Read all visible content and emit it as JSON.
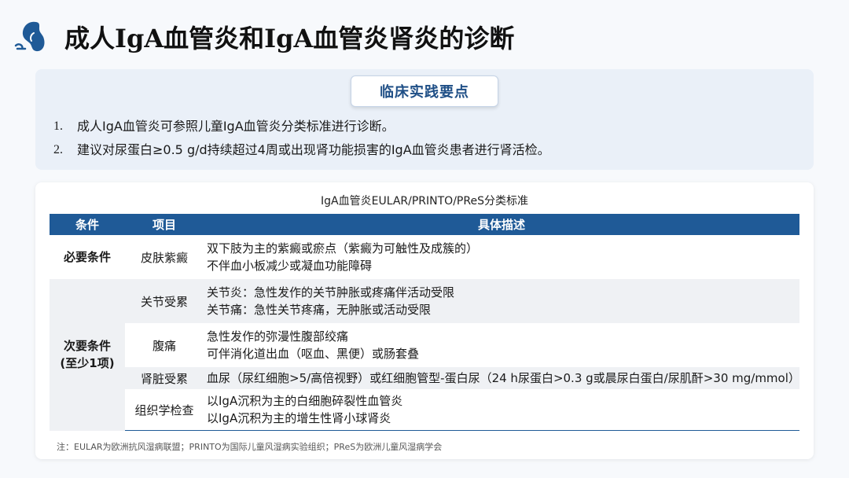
{
  "header": {
    "title": "成人IgA血管炎和IgA血管炎肾炎的诊断",
    "logo_icon": "kidney-icon",
    "accent_color": "#1f5a97"
  },
  "practice_points": {
    "heading": "临床实践要点",
    "items": [
      {
        "num": "1.",
        "text": "成人IgA血管炎可参照儿童IgA血管炎分类标准进行诊断。"
      },
      {
        "num": "2.",
        "text": "建议对尿蛋白≥0.5 g/d持续超过4周或出现肾功能损害的IgA血管炎患者进行肾活检。"
      }
    ]
  },
  "table": {
    "caption": "IgA血管炎EULAR/PRINTO/PReS分类标准",
    "headers": [
      "条件",
      "项目",
      "具体描述"
    ],
    "mandatory": {
      "condition": "必要条件",
      "item": "皮肤紫癜",
      "lines": [
        "双下肢为主的紫癜或瘀点（紫癜为可触性及成簇的）",
        "不伴血小板减少或凝血功能障碍"
      ]
    },
    "minor": {
      "condition_line1": "次要条件",
      "condition_line2": "(至少1项)",
      "rows": [
        {
          "item": "关节受累",
          "lines": [
            "关节炎：急性发作的关节肿胀或疼痛伴活动受限",
            "关节痛：急性关节疼痛，无肿胀或活动受限"
          ]
        },
        {
          "item": "腹痛",
          "lines": [
            "急性发作的弥漫性腹部绞痛",
            "可伴消化道出血（呕血、黑便）或肠套叠"
          ]
        },
        {
          "item": "肾脏受累",
          "lines": [
            "血尿（尿红细胞>5/高倍视野）或红细胞管型-蛋白尿（24 h尿蛋白>0.3 g或晨尿白蛋白/尿肌酐>30 mg/mmol）"
          ]
        },
        {
          "item": "组织学检查",
          "lines": [
            "以IgA沉积为主的白细胞碎裂性血管炎",
            "以IgA沉积为主的增生性肾小球肾炎"
          ]
        }
      ]
    }
  },
  "footnote": "注：EULAR为欧洲抗风湿病联盟；PRINTO为国际儿童风湿病实验组织；PReS为欧洲儿童风湿病学会"
}
